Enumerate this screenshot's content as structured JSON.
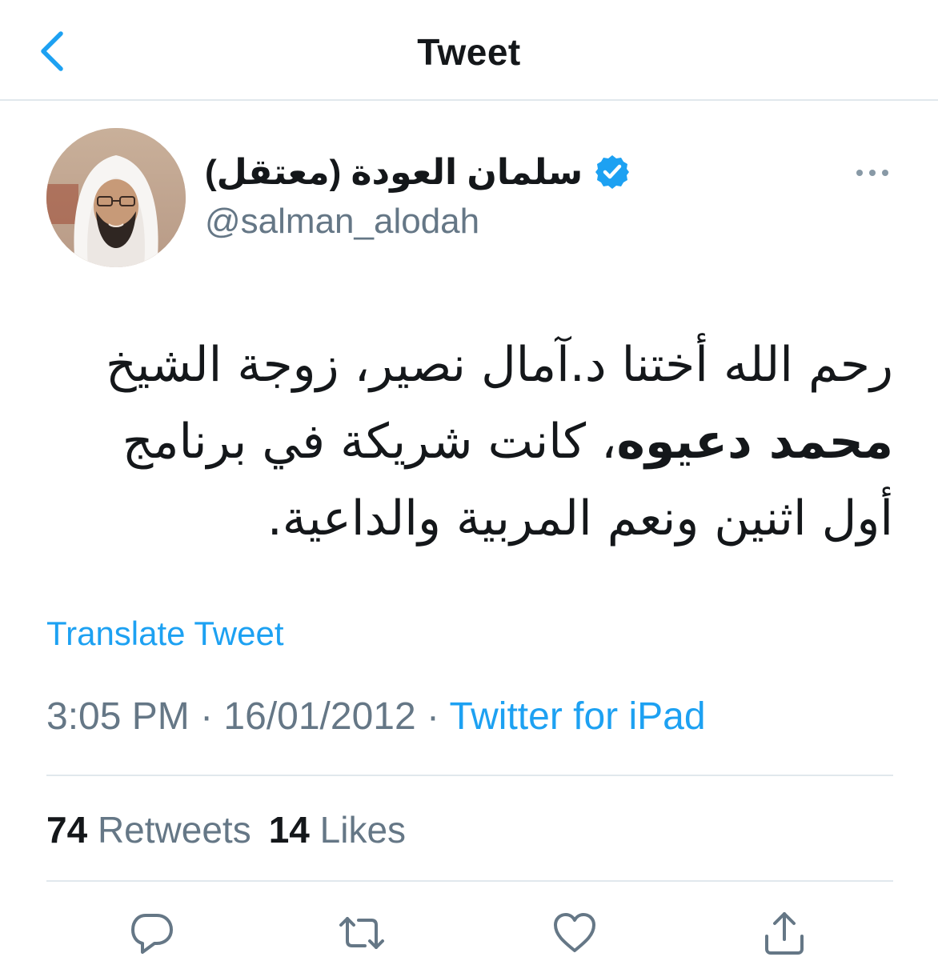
{
  "header": {
    "title": "Tweet",
    "back_icon": "chevron-left-icon"
  },
  "author": {
    "display_name": "سلمان العودة (معتقل)",
    "handle": "@salman_alodah",
    "verified": true,
    "verified_icon": "verified-badge-icon",
    "more_icon": "more-horizontal-icon"
  },
  "tweet": {
    "line1": "رحم الله أختنا د.آمال نصير، زوجة الشيخ",
    "line2_bold": "محمد دعيوه",
    "line2_rest": "، كانت شريكة في برنامج",
    "line3": "أول اثنين ونعم المربية والداعية.",
    "translate_label": "Translate Tweet"
  },
  "meta": {
    "time": "3:05 PM",
    "separator": " · ",
    "date": "16/01/2012",
    "source": "Twitter for iPad"
  },
  "stats": {
    "retweets_count": "74",
    "retweets_label": "Retweets",
    "likes_count": "14",
    "likes_label": "Likes"
  },
  "actions": [
    {
      "icon": "reply-icon"
    },
    {
      "icon": "retweet-icon"
    },
    {
      "icon": "like-icon"
    },
    {
      "icon": "share-icon"
    }
  ],
  "colors": {
    "accent": "#1da1f2",
    "secondary_text": "#657786",
    "primary_text": "#14171a",
    "divider": "#e1e8ed"
  }
}
